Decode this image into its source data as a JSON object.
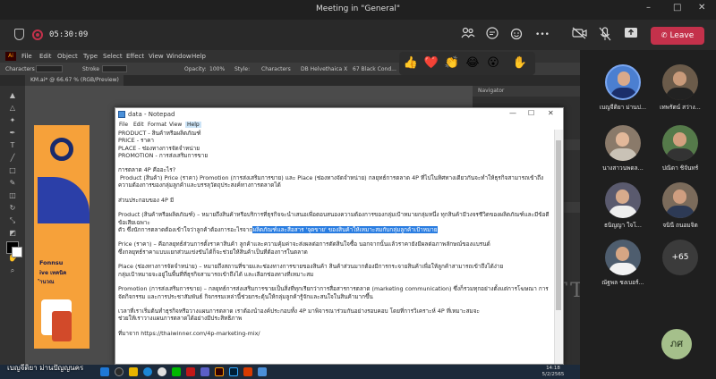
{
  "window": {
    "title": "Meeting in \"General\"",
    "minimize": "–",
    "maximize": "□",
    "close": "✕"
  },
  "meeting": {
    "timer": "05:30:09",
    "leave_label": "Leave",
    "icons": [
      "shield-icon",
      "record-icon",
      "people-icon",
      "chat-icon",
      "reactions-icon",
      "more-icon",
      "camera-off-icon",
      "mic-off-icon",
      "share-icon",
      "phone-icon"
    ],
    "more_glyph": "•••"
  },
  "reactions": [
    "👍",
    "❤️",
    "👏",
    "😂",
    "😮",
    "✋"
  ],
  "illustrator": {
    "logo": "Ai",
    "menu": [
      "File",
      "Edit",
      "Object",
      "Type",
      "Select",
      "Effect",
      "View",
      "Window",
      "Help"
    ],
    "control_bar": [
      "Characters",
      "Stroke",
      "Opacity:",
      "100%",
      "Style:",
      "Characters",
      "DB Helvethaica X",
      "67 Black Cond..."
    ],
    "doc_tab": "KM.ai* @ 66.67 % (RGB/Preview)",
    "panels": [
      "Navigator",
      "Libraries",
      "Properties"
    ],
    "poster_text": [
      "Fonnsu",
      "ive เทคนิค",
      "ำนวณ"
    ],
    "watermark": [
      "Y",
      "MUTT"
    ]
  },
  "notepad": {
    "title": "data - Notepad",
    "menu": [
      "File",
      "Edit",
      "Format",
      "View",
      "Help"
    ],
    "win_min": "—",
    "win_max": "☐",
    "win_close": "✕",
    "text": {
      "l1": "PRODUCT - สินค้าหรือผลิตภัณฑ์",
      "l2": "PRICE - ราคา",
      "l3": "PLACE - ช่องทางการจัดจำหน่าย",
      "l4": "PROMOTION - การส่งเสริมการขาย",
      "l5": "การตลาด 4P คืออะไร?",
      "l6": " Product (สินค้า) Price (ราคา) Promotion (การส่งเสริมการขาย) และ Place (ช่องทางจัดจำหน่าย) กลยุทธ์การตลาด 4P ที่ไปในทิศทางเดียวกันจะทำให้ธุรกิจสามารถเข้าถึง",
      "l7": "ความต้องการของกลุ่มลูกค้าและบรรลุวัตถุประสงค์ทางการตลาดได้",
      "l8": "ส่วนประกอบของ 4P มี",
      "l9": "Product (สินค้าหรือผลิตภัณฑ์) – หมายถึงสินค้าหรือบริการที่ธุรกิจจะนำเสนอเพื่อตอบสนองความต้องการของกลุ่มเป้าหมายกลุ่มหนึ่ง ทุกสินค้ามีวงจรชีวิตของผลิตภัณฑ์และมีข้อดีข้อเสียเฉพาะ",
      "l10a": "ตัว ซึ่งนักการตลาดต้องเข้าใจว่าลูกค้าต้องการอะไรจาก",
      "l10b": "ผลิตภัณฑ์และสื่อสาร 'จุดขาย' ของสินค้าให้เหมาะสมกับกลุ่มลูกค้าเป้าหมาย",
      "l11": "Price (ราคา) – คือกลยุทธ์ส่วนการตั้งราคาสินค้า ลูกค้าและความคุ้มค่าจะส่งผลต่อการตัดสินใจซื้อ นอกจากนั้นแล้วราคายังมีผลต่อภาพลักษณ์ของแบรนด์",
      "l12": "ซึ่งกลยุทธ์ราคาแบบแยกส่วนแข่งขันได้ก็จะช่วยให้สินค้าเป็นที่ต้องการในตลาด",
      "l13": "Place (ช่องทางการจัดจำหน่าย) – หมายถึงสถานที่ขายและช่องทางการขายของสินค้า สินค้าส่วนมากต้องมีการกระจายสินค้าเพื่อให้ลูกค้าสามารถเข้าถึงได้ง่าย",
      "l14": "กลุ่มเป้าหมายจะอยู่ในพื้นที่ที่ธุรกิจสามารถเข้าถึงได้ และเลือกช่องทางที่เหมาะสม",
      "l15": "Promotion (การส่งเสริมการขาย) – กลยุทธ์การส่งเสริมการขายเป็นสิ่งที่ทุกเรียกว่าการสื่อสารการตลาด (marketing communication) ซึ่งก็รวมทุกอย่างตั้งแต่การโฆษณา การ",
      "l16": "จัดกิจกรรม และการประชาสัมพันธ์ กิจกรรมเหล่านี้ช่วยกระตุ้นให้กลุ่มลูกค้ารู้จักและสนใจในสินค้ามากขึ้น",
      "l17": "เวลาที่เราเริ่มต้นทำธุรกิจหรือวางแผนการตลาด เราต้องนำองค์ประกอบทั้ง 4P มาพิจารณาร่วมกันอย่างรอบคอบ โดยที่การวิเคราะห์ 4P ที่เหมาะสมจะ",
      "l18": "ช่วยให้เราวางแผนการตลาดได้อย่างมีประสิทธิภาพ",
      "l19": "ที่มาจาก https://thaiwinner.com/4p-marketing-mix/"
    }
  },
  "taskbar": {
    "presenter": "เบญจีดิยา ม่านปัญญนคร",
    "time": "14:18",
    "date": "5/2/2565"
  },
  "participants": [
    {
      "name": "เบญจีดิยา ม่านป...",
      "color": "#4b7fd1",
      "skin": "#d9a98a"
    },
    {
      "name": "เทพรัตน์ สว่าง...",
      "color": "#6b5b4a",
      "skin": "#c89a7a"
    },
    {
      "name": "นางสาวนพดล...",
      "color": "#8a7a6a",
      "skin": "#e2b89a"
    },
    {
      "name": "ปณิดา ชิจันทร์",
      "color": "#557a4a",
      "skin": "#d4a07f"
    },
    {
      "name": "ธนิญญา ใจโ...",
      "color": "#5a5a6e",
      "skin": "#d8ab8c"
    },
    {
      "name": "จนินี ถนอมจิต",
      "color": "#7b6b5b",
      "skin": "#cf9e80"
    },
    {
      "name": "ณัฐพล ชงเบอร์...",
      "color": "#4e5d6e",
      "skin": "#d6a684"
    }
  ],
  "more_count": "+65",
  "me_initials": "ภศ"
}
